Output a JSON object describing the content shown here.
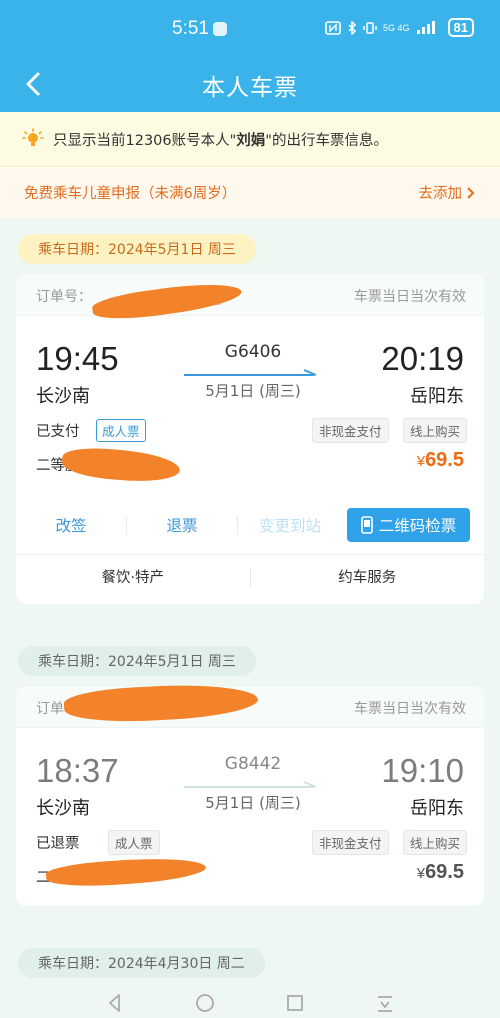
{
  "status_bar": {
    "time": "5:51",
    "network": "5G 4G",
    "battery": "81"
  },
  "header": {
    "title": "本人车票",
    "back_icon": "chevron-left-icon"
  },
  "notice": {
    "prefix": "只显示当前12306账号本人\"",
    "name": "刘娟",
    "suffix": "\"的出行车票信息。"
  },
  "child_declare": {
    "text": "免费乘车儿童申报（未满6周岁）",
    "link": "去添加",
    "link_icon": "chevron-right-icon"
  },
  "tickets": [
    {
      "date_label": "乘车日期：2024年5月1日 周三",
      "order_label": "订单号：",
      "refund_tag": "改签",
      "validity": "车票当日当次有效",
      "dep_time": "19:45",
      "arr_time": "20:19",
      "dep_station": "长沙南",
      "arr_station": "岳阳东",
      "train_no": "G6406",
      "train_date": "5月1日 (周三)",
      "pay_status": "已支付",
      "ticket_type": "成人票",
      "pay_method": "非现金支付",
      "channel": "线上购买",
      "seat": "二等座",
      "price": "69.5",
      "currency": "¥",
      "actions": [
        "改签",
        "退票",
        "变更到站"
      ],
      "qr_button": "二维码检票",
      "services": [
        "餐饮·特产",
        "约车服务"
      ]
    },
    {
      "date_label": "乘车日期：2024年5月1日 周三",
      "order_label": "订单",
      "validity": "车票当日当次有效",
      "dep_time": "18:37",
      "arr_time": "19:10",
      "dep_station": "长沙南",
      "arr_station": "岳阳东",
      "train_no": "G8442",
      "train_date": "5月1日 (周三)",
      "pay_status": "已退票",
      "ticket_type": "成人票",
      "pay_method": "非现金支付",
      "channel": "线上购买",
      "seat": "二等座",
      "price": "69.5",
      "currency": "¥"
    }
  ],
  "next_date_label": "乘车日期：2024年4月30日 周二",
  "colors": {
    "primary": "#3ab3ea",
    "accent_orange": "#ee6b12",
    "link_blue": "#3a9ad9"
  }
}
